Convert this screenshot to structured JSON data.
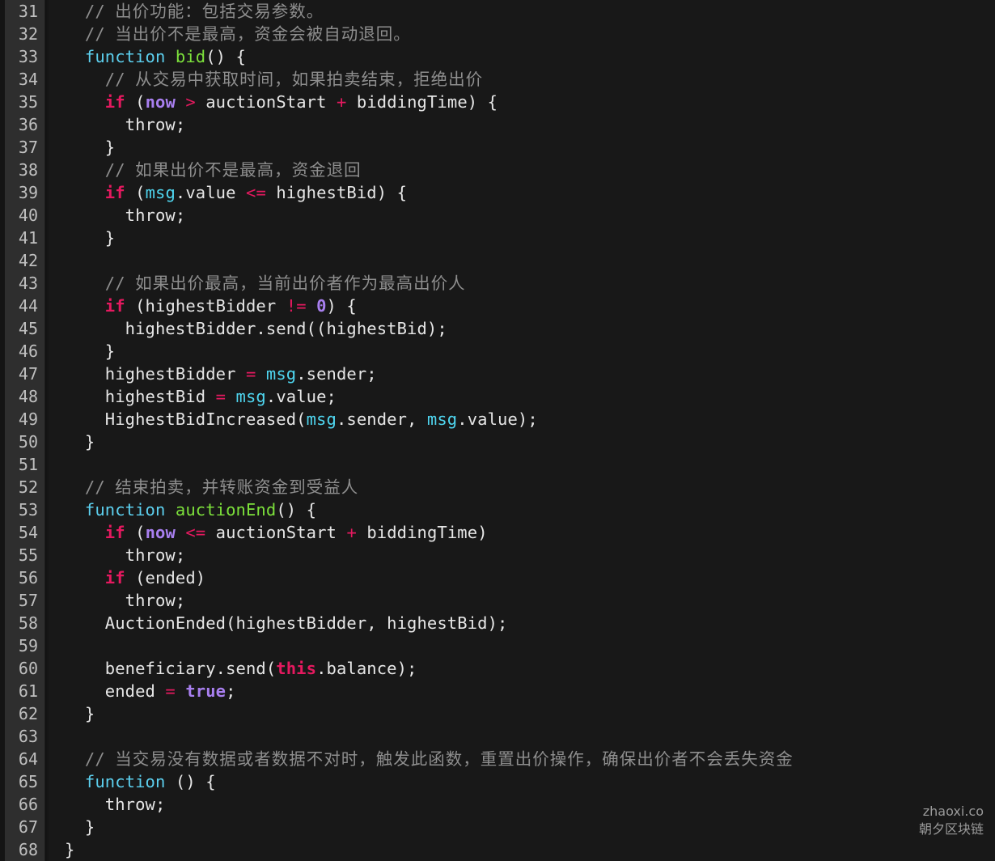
{
  "editor": {
    "first_line_number": 31,
    "last_line_number": 68,
    "language": "solidity",
    "theme": {
      "background": "#181818",
      "gutter_background": "#2e2e2e",
      "line_number_color": "#bfbfbf",
      "default_text": "#e6e6e6",
      "comment": "#8e8e8e",
      "keyword": "#e5195f",
      "function_keyword": "#5ccfee",
      "function_name": "#7ce03b",
      "constant": "#a87fef",
      "object": "#4fd6f0",
      "operator": "#e5195f"
    }
  },
  "watermark": {
    "line1": "zhaoxi.co",
    "line2": "朝夕区块链"
  },
  "lines": [
    {
      "n": "31",
      "tokens": [
        {
          "c": "comment",
          "t": "  // "
        },
        {
          "c": "comment cjk",
          "t": "出价功能：包括交易参数。"
        }
      ]
    },
    {
      "n": "32",
      "tokens": [
        {
          "c": "comment",
          "t": "  // "
        },
        {
          "c": "comment cjk",
          "t": "当出价不是最高，资金会被自动退回。"
        }
      ]
    },
    {
      "n": "33",
      "tokens": [
        {
          "c": "plain",
          "t": "  "
        },
        {
          "c": "fn",
          "t": "function"
        },
        {
          "c": "plain",
          "t": " "
        },
        {
          "c": "fname",
          "t": "bid"
        },
        {
          "c": "plain",
          "t": "() {"
        }
      ]
    },
    {
      "n": "34",
      "tokens": [
        {
          "c": "comment",
          "t": "    // "
        },
        {
          "c": "comment cjk",
          "t": "从交易中获取时间，如果拍卖结束，拒绝出价"
        }
      ]
    },
    {
      "n": "35",
      "tokens": [
        {
          "c": "plain",
          "t": "    "
        },
        {
          "c": "kw",
          "t": "if"
        },
        {
          "c": "plain",
          "t": " ("
        },
        {
          "c": "const",
          "t": "now"
        },
        {
          "c": "plain",
          "t": " "
        },
        {
          "c": "op",
          "t": ">"
        },
        {
          "c": "plain",
          "t": " auctionStart "
        },
        {
          "c": "op",
          "t": "+"
        },
        {
          "c": "plain",
          "t": " biddingTime) {"
        }
      ]
    },
    {
      "n": "36",
      "tokens": [
        {
          "c": "plain",
          "t": "      throw;"
        }
      ]
    },
    {
      "n": "37",
      "tokens": [
        {
          "c": "plain",
          "t": "    }"
        }
      ]
    },
    {
      "n": "38",
      "tokens": [
        {
          "c": "comment",
          "t": "    // "
        },
        {
          "c": "comment cjk",
          "t": "如果出价不是最高，资金退回"
        }
      ]
    },
    {
      "n": "39",
      "tokens": [
        {
          "c": "plain",
          "t": "    "
        },
        {
          "c": "kw",
          "t": "if"
        },
        {
          "c": "plain",
          "t": " ("
        },
        {
          "c": "obj",
          "t": "msg"
        },
        {
          "c": "plain",
          "t": ".value "
        },
        {
          "c": "op",
          "t": "<="
        },
        {
          "c": "plain",
          "t": " highestBid) {"
        }
      ]
    },
    {
      "n": "40",
      "tokens": [
        {
          "c": "plain",
          "t": "      throw;"
        }
      ]
    },
    {
      "n": "41",
      "tokens": [
        {
          "c": "plain",
          "t": "    }"
        }
      ]
    },
    {
      "n": "42",
      "tokens": [
        {
          "c": "plain",
          "t": ""
        }
      ]
    },
    {
      "n": "43",
      "tokens": [
        {
          "c": "comment",
          "t": "    // "
        },
        {
          "c": "comment cjk",
          "t": "如果出价最高，当前出价者作为最高出价人"
        }
      ]
    },
    {
      "n": "44",
      "tokens": [
        {
          "c": "plain",
          "t": "    "
        },
        {
          "c": "kw",
          "t": "if"
        },
        {
          "c": "plain",
          "t": " (highestBidder "
        },
        {
          "c": "op",
          "t": "!="
        },
        {
          "c": "plain",
          "t": " "
        },
        {
          "c": "num",
          "t": "0"
        },
        {
          "c": "plain",
          "t": ") {"
        }
      ]
    },
    {
      "n": "45",
      "tokens": [
        {
          "c": "plain",
          "t": "      highestBidder.send((highestBid);"
        }
      ]
    },
    {
      "n": "46",
      "tokens": [
        {
          "c": "plain",
          "t": "    }"
        }
      ]
    },
    {
      "n": "47",
      "tokens": [
        {
          "c": "plain",
          "t": "    highestBidder "
        },
        {
          "c": "op",
          "t": "="
        },
        {
          "c": "plain",
          "t": " "
        },
        {
          "c": "obj",
          "t": "msg"
        },
        {
          "c": "plain",
          "t": ".sender;"
        }
      ]
    },
    {
      "n": "48",
      "tokens": [
        {
          "c": "plain",
          "t": "    highestBid "
        },
        {
          "c": "op",
          "t": "="
        },
        {
          "c": "plain",
          "t": " "
        },
        {
          "c": "obj",
          "t": "msg"
        },
        {
          "c": "plain",
          "t": ".value;"
        }
      ]
    },
    {
      "n": "49",
      "tokens": [
        {
          "c": "plain",
          "t": "    HighestBidIncreased("
        },
        {
          "c": "obj",
          "t": "msg"
        },
        {
          "c": "plain",
          "t": ".sender, "
        },
        {
          "c": "obj",
          "t": "msg"
        },
        {
          "c": "plain",
          "t": ".value);"
        }
      ]
    },
    {
      "n": "50",
      "tokens": [
        {
          "c": "plain",
          "t": "  }"
        }
      ]
    },
    {
      "n": "51",
      "tokens": [
        {
          "c": "plain",
          "t": ""
        }
      ]
    },
    {
      "n": "52",
      "tokens": [
        {
          "c": "comment",
          "t": "  // "
        },
        {
          "c": "comment cjk",
          "t": "结束拍卖，并转账资金到受益人"
        }
      ]
    },
    {
      "n": "53",
      "tokens": [
        {
          "c": "plain",
          "t": "  "
        },
        {
          "c": "fn",
          "t": "function"
        },
        {
          "c": "plain",
          "t": " "
        },
        {
          "c": "fname",
          "t": "auctionEnd"
        },
        {
          "c": "plain",
          "t": "() {"
        }
      ]
    },
    {
      "n": "54",
      "tokens": [
        {
          "c": "plain",
          "t": "    "
        },
        {
          "c": "kw",
          "t": "if"
        },
        {
          "c": "plain",
          "t": " ("
        },
        {
          "c": "const",
          "t": "now"
        },
        {
          "c": "plain",
          "t": " "
        },
        {
          "c": "op",
          "t": "<="
        },
        {
          "c": "plain",
          "t": " auctionStart "
        },
        {
          "c": "op",
          "t": "+"
        },
        {
          "c": "plain",
          "t": " biddingTime)"
        }
      ]
    },
    {
      "n": "55",
      "tokens": [
        {
          "c": "plain",
          "t": "      throw;"
        }
      ]
    },
    {
      "n": "56",
      "tokens": [
        {
          "c": "plain",
          "t": "    "
        },
        {
          "c": "kw",
          "t": "if"
        },
        {
          "c": "plain",
          "t": " (ended)"
        }
      ]
    },
    {
      "n": "57",
      "tokens": [
        {
          "c": "plain",
          "t": "      throw;"
        }
      ]
    },
    {
      "n": "58",
      "tokens": [
        {
          "c": "plain",
          "t": "    AuctionEnded(highestBidder, highestBid);"
        }
      ]
    },
    {
      "n": "59",
      "tokens": [
        {
          "c": "plain",
          "t": ""
        }
      ]
    },
    {
      "n": "60",
      "tokens": [
        {
          "c": "plain",
          "t": "    beneficiary.send("
        },
        {
          "c": "this",
          "t": "this"
        },
        {
          "c": "plain",
          "t": ".balance);"
        }
      ]
    },
    {
      "n": "61",
      "tokens": [
        {
          "c": "plain",
          "t": "    ended "
        },
        {
          "c": "op",
          "t": "="
        },
        {
          "c": "plain",
          "t": " "
        },
        {
          "c": "const",
          "t": "true"
        },
        {
          "c": "plain",
          "t": ";"
        }
      ]
    },
    {
      "n": "62",
      "tokens": [
        {
          "c": "plain",
          "t": "  }"
        }
      ]
    },
    {
      "n": "63",
      "tokens": [
        {
          "c": "plain",
          "t": ""
        }
      ]
    },
    {
      "n": "64",
      "tokens": [
        {
          "c": "comment",
          "t": "  // "
        },
        {
          "c": "comment cjk",
          "t": "当交易没有数据或者数据不对时，触发此函数，重置出价操作，确保出价者不会丢失资金"
        }
      ]
    },
    {
      "n": "65",
      "tokens": [
        {
          "c": "plain",
          "t": "  "
        },
        {
          "c": "fn",
          "t": "function"
        },
        {
          "c": "plain",
          "t": " () {"
        }
      ]
    },
    {
      "n": "66",
      "tokens": [
        {
          "c": "plain",
          "t": "    throw;"
        }
      ]
    },
    {
      "n": "67",
      "tokens": [
        {
          "c": "plain",
          "t": "  }"
        }
      ]
    },
    {
      "n": "68",
      "tokens": [
        {
          "c": "plain",
          "t": "}"
        }
      ]
    }
  ]
}
